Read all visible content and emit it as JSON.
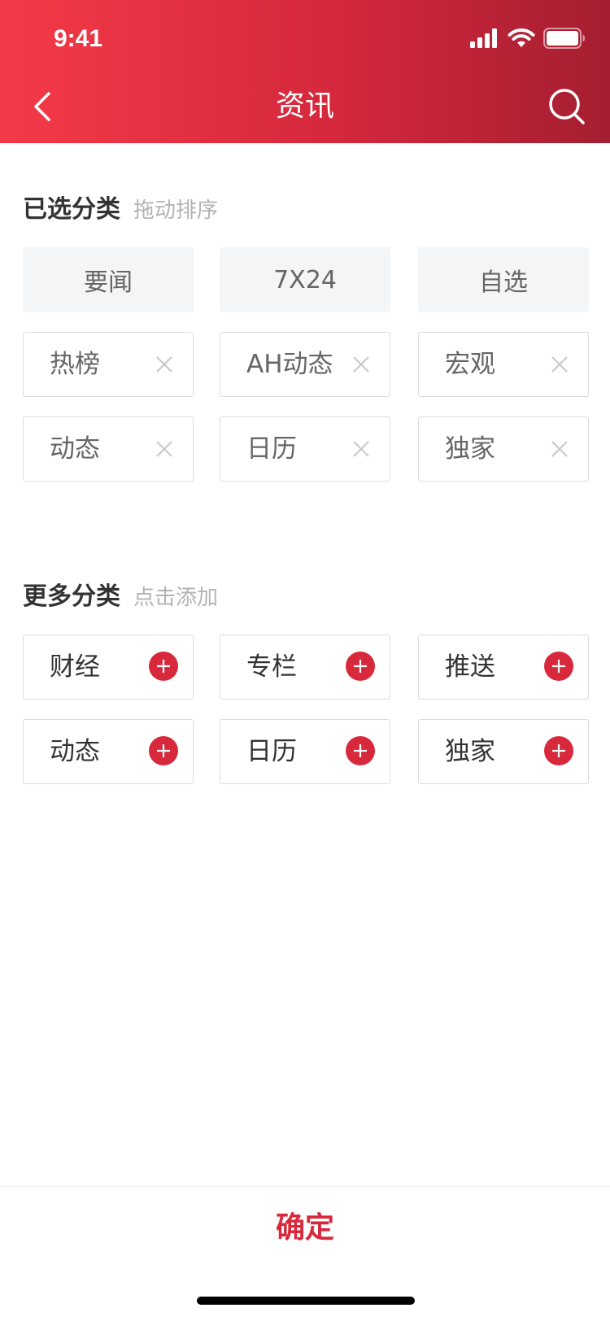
{
  "status_bar": {
    "time": "9:41"
  },
  "nav": {
    "title": "资讯",
    "back_icon": "chevron-left-icon",
    "search_icon": "search-icon"
  },
  "selected_section": {
    "title": "已选分类",
    "hint": "拖动排序",
    "fixed_tags": [
      "要闻",
      "7X24",
      "自选"
    ],
    "removable_tags": [
      "热榜",
      "AH动态",
      "宏观",
      "动态",
      "日历",
      "独家"
    ]
  },
  "more_section": {
    "title": "更多分类",
    "hint": "点击添加",
    "tags": [
      "财经",
      "专栏",
      "推送",
      "动态",
      "日历",
      "独家"
    ]
  },
  "footer": {
    "confirm_label": "确定"
  },
  "colors": {
    "accent": "#d8283c",
    "header_start": "#f43a48",
    "header_end": "#a51e31"
  }
}
